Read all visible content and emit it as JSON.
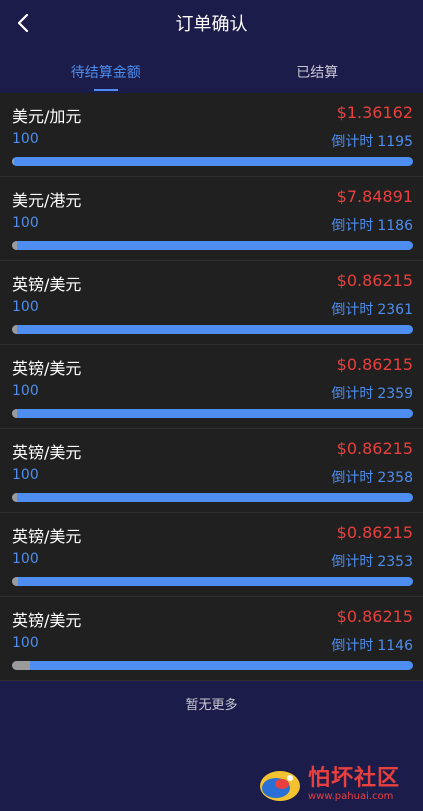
{
  "header": {
    "title": "订单确认",
    "back_icon": "chevron-left-icon"
  },
  "tabs": [
    {
      "label": "待结算金额",
      "active": true
    },
    {
      "label": "已结算",
      "active": false
    }
  ],
  "orders": [
    {
      "pair": "美元/加元",
      "price": "$1.36162",
      "amount": "100",
      "countdown_label": "倒计时",
      "countdown": "1195",
      "progress": 0.005
    },
    {
      "pair": "美元/港元",
      "price": "$7.84891",
      "amount": "100",
      "countdown_label": "倒计时",
      "countdown": "1186",
      "progress": 0.012
    },
    {
      "pair": "英镑/美元",
      "price": "$0.86215",
      "amount": "100",
      "countdown_label": "倒计时",
      "countdown": "2361",
      "progress": 0.012
    },
    {
      "pair": "英镑/美元",
      "price": "$0.86215",
      "amount": "100",
      "countdown_label": "倒计时",
      "countdown": "2359",
      "progress": 0.012
    },
    {
      "pair": "英镑/美元",
      "price": "$0.86215",
      "amount": "100",
      "countdown_label": "倒计时",
      "countdown": "2358",
      "progress": 0.012
    },
    {
      "pair": "英镑/美元",
      "price": "$0.86215",
      "amount": "100",
      "countdown_label": "倒计时",
      "countdown": "2353",
      "progress": 0.014
    },
    {
      "pair": "英镑/美元",
      "price": "$0.86215",
      "amount": "100",
      "countdown_label": "倒计时",
      "countdown": "1146",
      "progress": 0.045
    }
  ],
  "footer": {
    "no_more": "暂无更多"
  },
  "watermark": {
    "title": "怕坏社区",
    "url": "www.pahuai.com"
  },
  "colors": {
    "background": "#1c1c4a",
    "card": "#202020",
    "accent": "#4d8ef0",
    "price": "#e8403e",
    "progress_done": "#9b9b9b"
  }
}
